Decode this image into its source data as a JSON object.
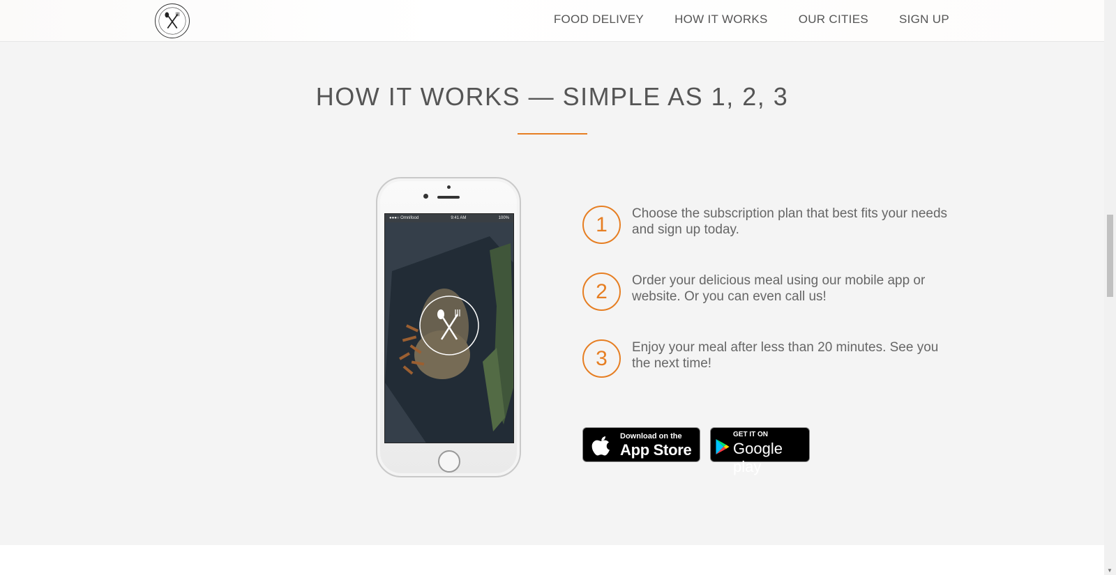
{
  "nav": {
    "links": [
      "FOOD DELIVEY",
      "HOW IT WORKS",
      "OUR CITIES",
      "SIGN UP"
    ]
  },
  "section": {
    "title": "HOW IT WORKS — SIMPLE AS 1, 2, 3",
    "accent_color": "#e67e22"
  },
  "phone": {
    "status_left": "●●●○ Omnifood",
    "status_time": "9:41 AM",
    "status_right": "100%"
  },
  "steps": [
    {
      "number": "1",
      "text": "Choose the subscription plan that best fits your needs and sign up today."
    },
    {
      "number": "2",
      "text": "Order your delicious meal using our mobile app or website. Or you can even call us!"
    },
    {
      "number": "3",
      "text": "Enjoy your meal after less than 20 minutes. See you the next time!"
    }
  ],
  "badges": {
    "apple": {
      "small": "Download on the",
      "big": "App Store",
      "icon": "apple-icon"
    },
    "google": {
      "small": "GET IT ON",
      "big": "Google play",
      "icon": "google-play-icon"
    }
  }
}
